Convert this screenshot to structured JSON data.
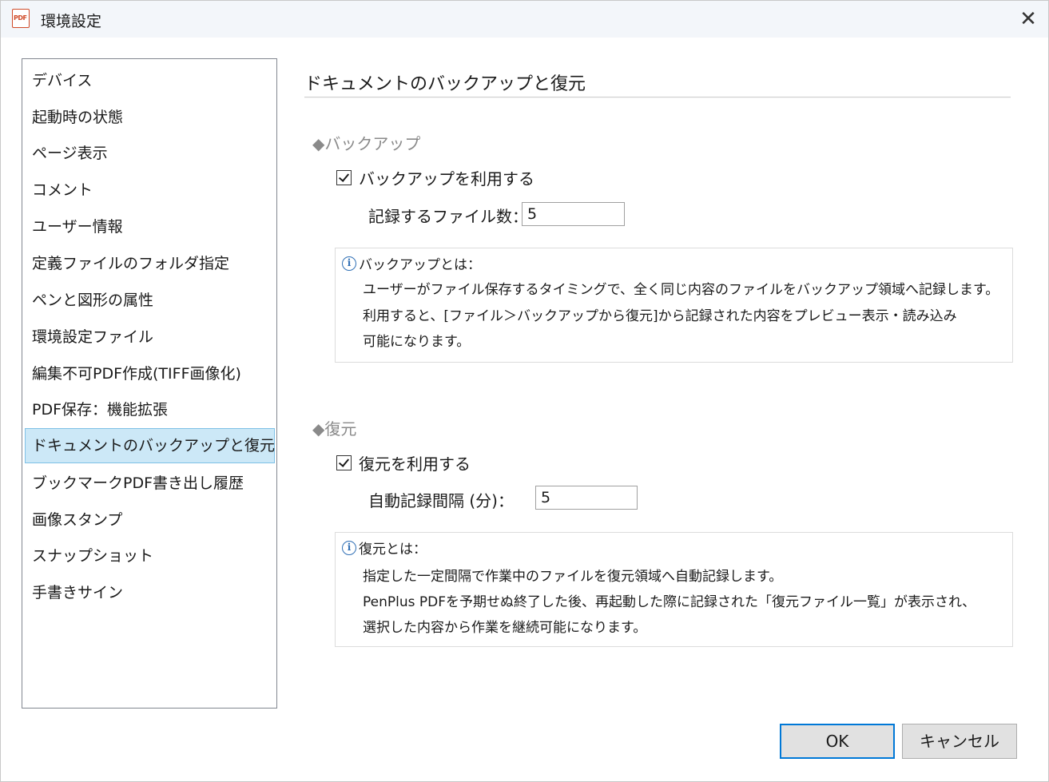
{
  "window": {
    "title": "環境設定",
    "app_icon_text": "PDF",
    "close_glyph": "✕"
  },
  "sidebar": {
    "items": [
      {
        "label": "デバイス"
      },
      {
        "label": "起動時の状態"
      },
      {
        "label": "ページ表示"
      },
      {
        "label": "コメント"
      },
      {
        "label": "ユーザー情報"
      },
      {
        "label": "定義ファイルのフォルダ指定"
      },
      {
        "label": "ペンと図形の属性"
      },
      {
        "label": "環境設定ファイル"
      },
      {
        "label": "編集不可PDF作成(TIFF画像化)"
      },
      {
        "label": "PDF保存：機能拡張"
      },
      {
        "label": "ドキュメントのバックアップと復元"
      },
      {
        "label": "ブックマークPDF書き出し履歴"
      },
      {
        "label": "画像スタンプ"
      },
      {
        "label": "スナップショット"
      },
      {
        "label": "手書きサイン"
      }
    ],
    "selected_index": 10
  },
  "main": {
    "title": "ドキュメントのバックアップと復元",
    "backup": {
      "group_title": "◆バックアップ",
      "checkbox_label": "バックアップを利用する",
      "checked": true,
      "count_label": "記録するファイル数：",
      "count_value": "5",
      "info_title": "バックアップとは：",
      "info_lines": [
        "ユーザーがファイル保存するタイミングで、全く同じ内容のファイルをバックアップ領域へ記録します。",
        "利用すると、[ファイル＞バックアップから復元]から記録された内容をプレビュー表示・読み込み",
        "可能になります。"
      ]
    },
    "restore": {
      "group_title": "◆復元",
      "checkbox_label": "復元を利用する",
      "checked": true,
      "interval_label": "自動記録間隔 (分)：",
      "interval_value": "5",
      "info_title": "復元とは：",
      "info_lines": [
        "指定した一定間隔で作業中のファイルを復元領域へ自動記録します。",
        "PenPlus PDFを予期せぬ終了した後、再起動した際に記録された「復元ファイル一覧」が表示され、",
        "選択した内容から作業を継続可能になります。"
      ]
    }
  },
  "buttons": {
    "ok": "OK",
    "cancel": "キャンセル"
  },
  "colors": {
    "selection_bg": "#cce8f7",
    "selection_border": "#7ec0e6",
    "default_button_border": "#0078d7",
    "group_title": "#8a8a8a"
  }
}
